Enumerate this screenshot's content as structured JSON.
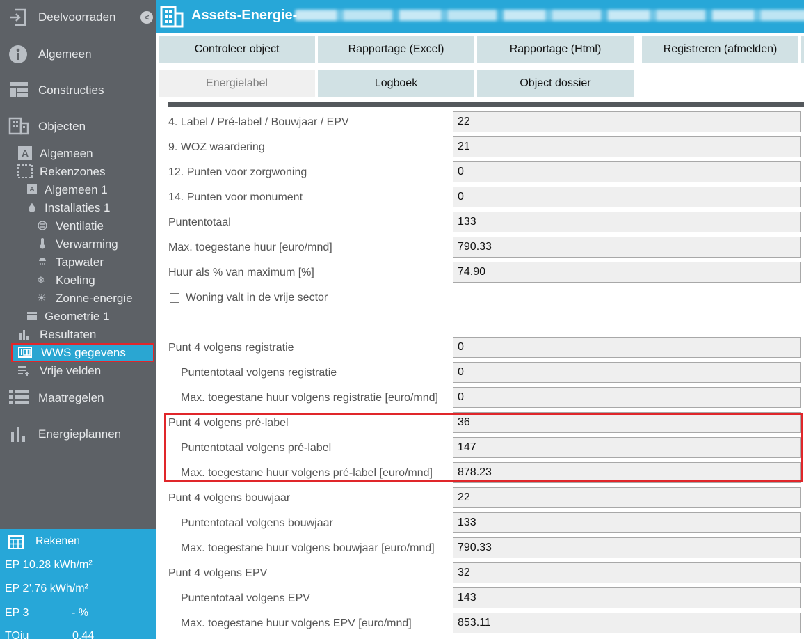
{
  "sidebar": {
    "collapse_label": "<",
    "items": [
      {
        "label": "Deelvoorraden"
      },
      {
        "label": "Algemeen"
      },
      {
        "label": "Constructies"
      },
      {
        "label": "Objecten"
      },
      {
        "label": "Algemeen"
      },
      {
        "label": "Rekenzones"
      },
      {
        "label": "Algemeen 1"
      },
      {
        "label": "Installaties 1"
      },
      {
        "label": "Ventilatie"
      },
      {
        "label": "Verwarming"
      },
      {
        "label": "Tapwater"
      },
      {
        "label": "Koeling"
      },
      {
        "label": "Zonne-energie"
      },
      {
        "label": "Geometrie 1"
      },
      {
        "label": "Resultaten"
      },
      {
        "label": "WWS gegevens"
      },
      {
        "label": "Vrije velden"
      },
      {
        "label": "Maatregelen"
      },
      {
        "label": "Energieplannen"
      }
    ],
    "selected": "WWS gegevens"
  },
  "rekenen": {
    "title": "Rekenen",
    "rows": [
      {
        "label": "EP 1",
        "value": "0.28 kWh/m²"
      },
      {
        "label": "EP 2",
        "value": "'.76 kWh/m²"
      },
      {
        "label": "EP 3",
        "value": "-   %"
      },
      {
        "label": "TOju",
        "value": "0.44"
      }
    ]
  },
  "header": {
    "title": "Assets-Energie-"
  },
  "toolbar": {
    "row1": [
      "Controleer object",
      "Rapportage (Excel)",
      "Rapportage (Html)",
      "Registreren (afmelden)"
    ],
    "row2": [
      "Energielabel",
      "Logboek",
      "Object dossier"
    ]
  },
  "form": {
    "rows": [
      {
        "label": "4. Label / Pré-label / Bouwjaar / EPV",
        "value": "22"
      },
      {
        "label": "9. WOZ waardering",
        "value": "21"
      },
      {
        "label": "12. Punten voor zorgwoning",
        "value": "0"
      },
      {
        "label": "14. Punten voor monument",
        "value": "0"
      },
      {
        "label": "Puntentotaal",
        "value": "133"
      },
      {
        "label": "Max. toegestane huur [euro/mnd]",
        "value": "790.33"
      },
      {
        "label": "Huur als % van maximum [%]",
        "value": "74.90"
      }
    ],
    "checkbox_label": "Woning valt in de vrije sector",
    "groups": [
      {
        "label": "Punt 4 volgens registratie",
        "value": "0",
        "sub": [
          {
            "label": "Puntentotaal volgens registratie",
            "value": "0"
          },
          {
            "label": "Max. toegestane huur volgens registratie [euro/mnd]",
            "value": "0"
          }
        ]
      },
      {
        "label": "Punt 4 volgens pré-label",
        "value": "36",
        "sub": [
          {
            "label": "Puntentotaal volgens pré-label",
            "value": "147"
          },
          {
            "label": "Max. toegestane huur volgens pré-label [euro/mnd]",
            "value": "878.23"
          }
        ]
      },
      {
        "label": "Punt 4 volgens bouwjaar",
        "value": "22",
        "sub": [
          {
            "label": "Puntentotaal volgens bouwjaar",
            "value": "133"
          },
          {
            "label": "Max. toegestane huur volgens bouwjaar [euro/mnd]",
            "value": "790.33"
          }
        ]
      },
      {
        "label": "Punt 4 volgens EPV",
        "value": "32",
        "sub": [
          {
            "label": "Puntentotaal volgens EPV",
            "value": "143"
          },
          {
            "label": "Max. toegestane huur volgens EPV [euro/mnd]",
            "value": "853.11"
          }
        ]
      }
    ]
  }
}
